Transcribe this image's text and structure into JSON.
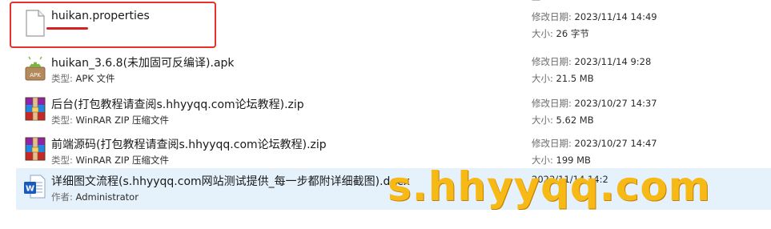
{
  "top_partial": "—",
  "files": [
    {
      "name": "huikan.properties",
      "sub_label": "",
      "sub_value": "",
      "meta1_label": "修改日期:",
      "meta1_value": "2023/11/14 14:49",
      "meta2_label": "大小:",
      "meta2_value": "26 字节",
      "icon": "text-file-icon"
    },
    {
      "name": "huikan_3.6.8(未加固可反编译).apk",
      "sub_label": "类型:",
      "sub_value": "APK 文件",
      "meta1_label": "修改日期:",
      "meta1_value": "2023/11/14 9:28",
      "meta2_label": "大小:",
      "meta2_value": "21.5 MB",
      "icon": "apk-android-icon"
    },
    {
      "name": "后台(打包教程请查阅s.hhyyqq.com论坛教程).zip",
      "sub_label": "类型:",
      "sub_value": "WinRAR ZIP 压缩文件",
      "meta1_label": "修改日期:",
      "meta1_value": "2023/10/27 14:37",
      "meta2_label": "大小:",
      "meta2_value": "5.62 MB",
      "icon": "winrar-archive-icon"
    },
    {
      "name": "前端源码(打包教程请查阅s.hhyyqq.com论坛教程).zip",
      "sub_label": "类型:",
      "sub_value": "WinRAR ZIP 压缩文件",
      "meta1_label": "修改日期:",
      "meta1_value": "2023/10/27 14:47",
      "meta2_label": "大小:",
      "meta2_value": "199 MB",
      "icon": "winrar-archive-icon"
    },
    {
      "name": "详细图文流程(s.hhyyqq.com网站测试提供_每一步都附详细截图).docx",
      "sub_label": "作者:",
      "sub_value": "Administrator",
      "meta1_label": "",
      "meta1_value": "2023/11/14 14:2",
      "meta2_label": "",
      "meta2_value": "",
      "icon": "word-document-icon"
    }
  ],
  "watermark": "s.hhyyqq.com",
  "colors": {
    "selection": "#e5f1fb",
    "annotation_red": "#e8302c",
    "watermark": "#f6b916"
  }
}
